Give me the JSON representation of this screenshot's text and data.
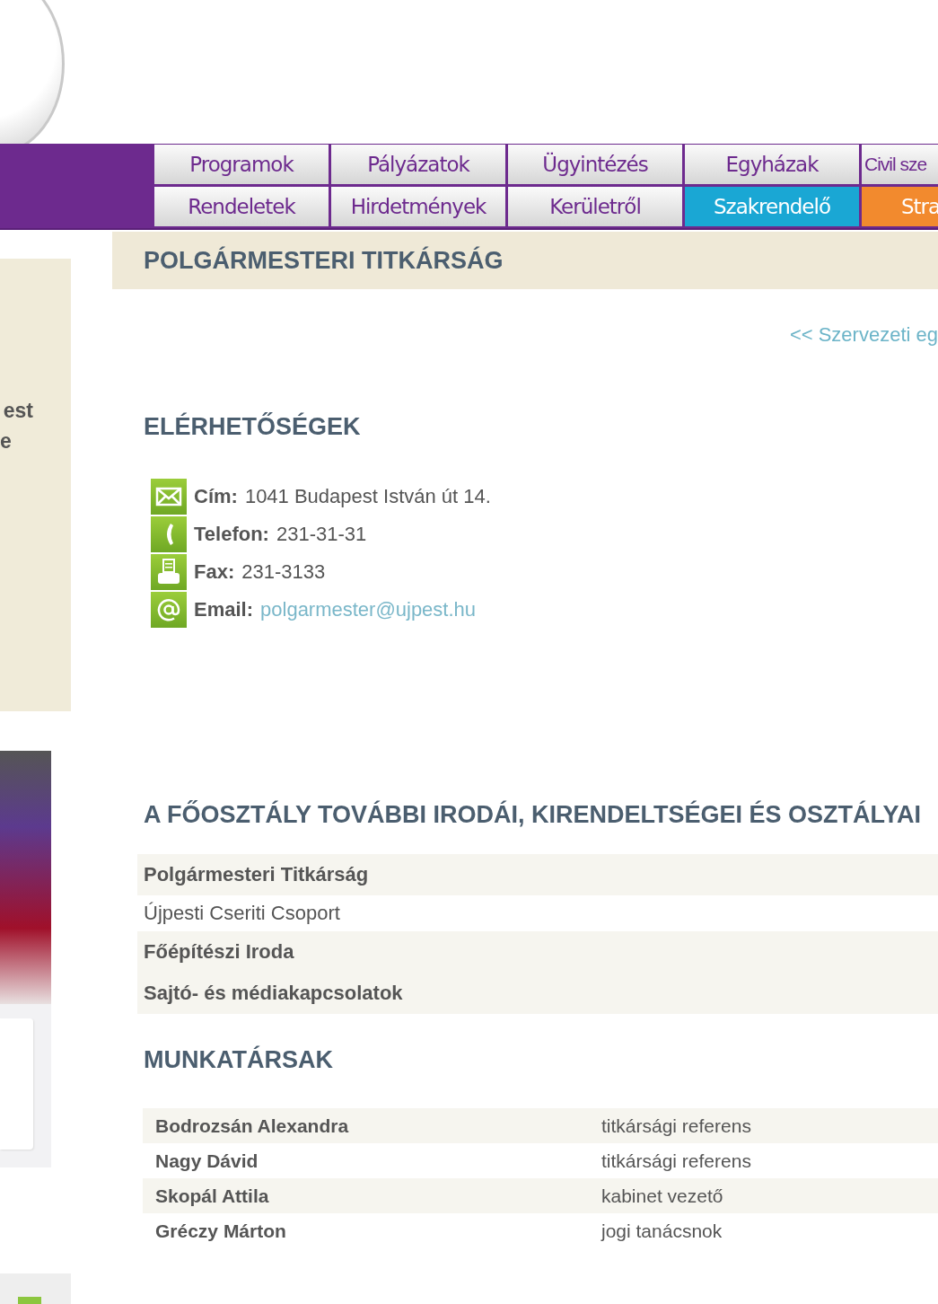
{
  "sidebar": {
    "texts": [
      "est",
      "e"
    ]
  },
  "nav": {
    "rows": [
      [
        {
          "label": "Programok",
          "kind": "plain"
        },
        {
          "label": "Pályázatok",
          "kind": "plain"
        },
        {
          "label": "Ügyintézés",
          "kind": "plain"
        },
        {
          "label": "Egyházak",
          "kind": "plain"
        },
        {
          "label": "Civil sze",
          "kind": "plain"
        }
      ],
      [
        {
          "label": "Rendeletek",
          "kind": "plain"
        },
        {
          "label": "Hirdetmények",
          "kind": "plain"
        },
        {
          "label": "Kerületről",
          "kind": "plain"
        },
        {
          "label": "Szakrendelő",
          "kind": "colored",
          "color": "#1aa7d4"
        },
        {
          "label": "Stra",
          "kind": "colored",
          "color": "#f28a2e"
        }
      ]
    ]
  },
  "page_title": "POLGÁRMESTERI TITKÁRSÁG",
  "back_link": "<< Szervezeti eg",
  "contacts": {
    "heading": "ELÉRHETŐSÉGEK",
    "items": [
      {
        "kind": "address",
        "label": "Cím:",
        "value": "1041 Budapest István út 14.",
        "link": false
      },
      {
        "kind": "phone",
        "label": "Telefon:",
        "value": "231-31-31",
        "link": false
      },
      {
        "kind": "fax",
        "label": "Fax:",
        "value": "231-3133",
        "link": false
      },
      {
        "kind": "email",
        "label": "Email:",
        "value": "polgarmester@ujpest.hu",
        "link": true
      }
    ]
  },
  "offices": {
    "heading": "A FŐOSZTÁLY TOVÁBBI IRODÁI, KIRENDELTSÉGEI ÉS OSZTÁLYAI",
    "rows": [
      {
        "name": "Polgármesteri Titkárság",
        "emphasized": true
      },
      {
        "name": "Újpesti Cseriti Csoport",
        "emphasized": false
      },
      {
        "name": "Főépítészi Iroda",
        "emphasized": true
      },
      {
        "name": "Sajtó- és médiakapcsolatok",
        "emphasized": true
      }
    ]
  },
  "staff": {
    "heading": "MUNKATÁRSAK",
    "rows": [
      {
        "name": "Bodrozsán Alexandra",
        "role": "titkársági referens"
      },
      {
        "name": "Nagy Dávid",
        "role": "titkársági referens"
      },
      {
        "name": "Skopál Attila",
        "role": "kabinet vezető"
      },
      {
        "name": "Gréczy Márton",
        "role": "jogi tanácsnok"
      }
    ]
  }
}
